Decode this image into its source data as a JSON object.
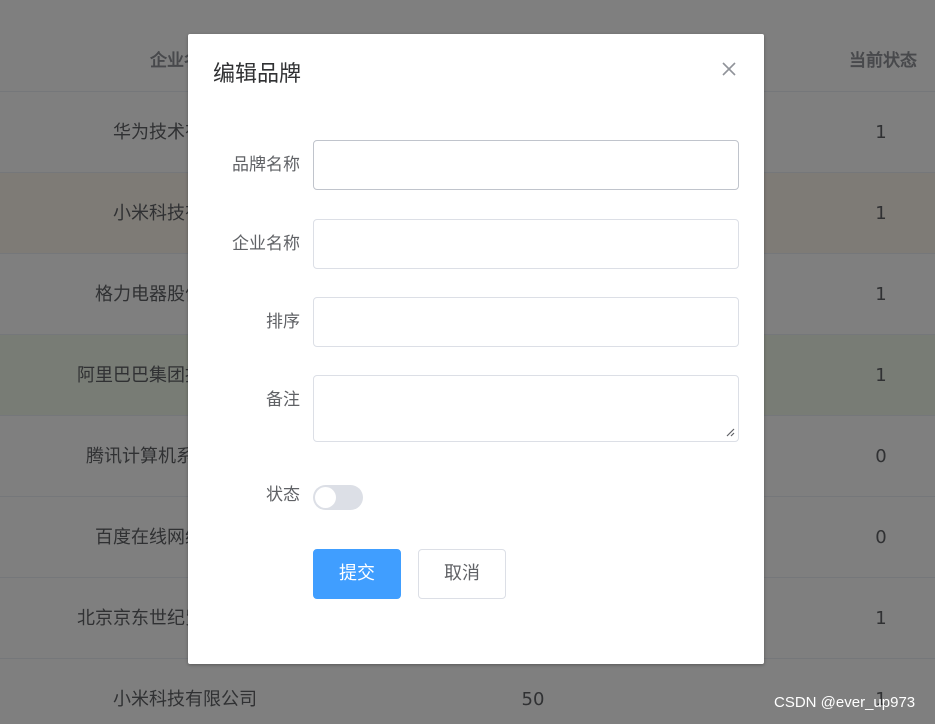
{
  "table": {
    "headers": {
      "company": "企业名称",
      "status": "当前状态"
    },
    "rows": [
      {
        "company": "华为技术有限公司",
        "order": "",
        "status": "1"
      },
      {
        "company": "小米科技有限公司",
        "order": "",
        "status": "1"
      },
      {
        "company": "格力电器股份有限公司",
        "order": "",
        "status": "1"
      },
      {
        "company": "阿里巴巴集团控股有限公司",
        "order": "",
        "status": "1"
      },
      {
        "company": "腾讯计算机系统有限公司",
        "order": "",
        "status": "0"
      },
      {
        "company": "百度在线网络技术公司",
        "order": "",
        "status": "0"
      },
      {
        "company": "北京京东世纪贸易有限公司",
        "order": "",
        "status": "1"
      },
      {
        "company": "小米科技有限公司",
        "order": "50",
        "status": "1"
      }
    ]
  },
  "dialog": {
    "title": "编辑品牌",
    "fields": {
      "brand_name": {
        "label": "品牌名称",
        "value": ""
      },
      "company_name": {
        "label": "企业名称",
        "value": ""
      },
      "order": {
        "label": "排序",
        "value": ""
      },
      "remark": {
        "label": "备注",
        "value": ""
      },
      "status": {
        "label": "状态",
        "on": false
      }
    },
    "submit_label": "提交",
    "cancel_label": "取消"
  },
  "watermark": "CSDN @ever_up973",
  "colors": {
    "primary": "#409eff",
    "overlay": "rgba(0,0,0,0.5)",
    "row_warning": "#fdf6ec",
    "row_success": "#f0f9eb"
  },
  "icons": {
    "close": "close-icon",
    "resize": "resize-grip-icon"
  }
}
